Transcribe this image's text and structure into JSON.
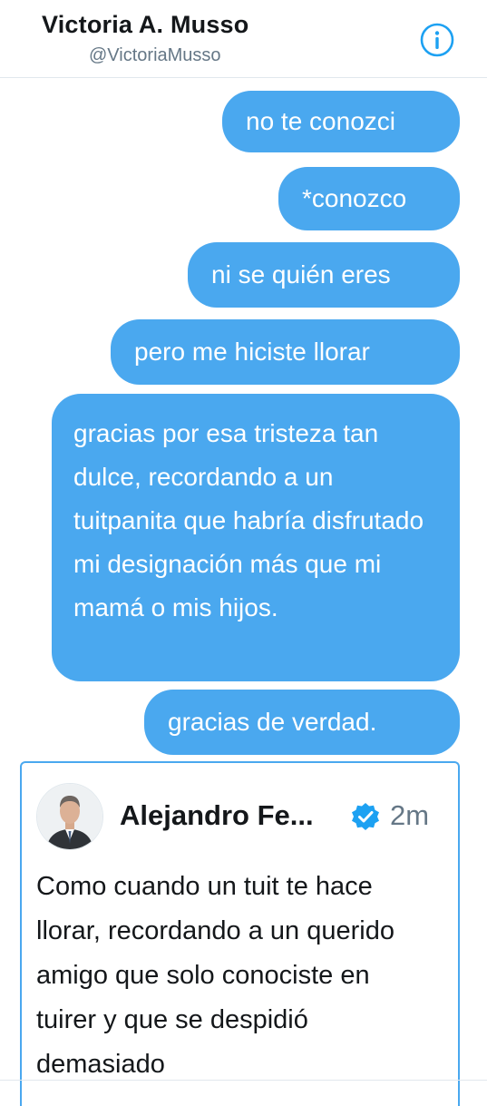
{
  "header": {
    "name": "Victoria A. Musso",
    "handle": "@VictoriaMusso",
    "info_icon": "info-circle-icon"
  },
  "messages": [
    {
      "text": "no te conozci"
    },
    {
      "text": "*conozco"
    },
    {
      "text": "ni se quién eres"
    },
    {
      "text": "pero me hiciste llorar"
    },
    {
      "text": "gracias por esa tristeza tan dulce, recordando a un tuitpanita que habría disfrutado mi designación más que mi mamá o mis hijos."
    },
    {
      "text": "gracias de verdad."
    }
  ],
  "shared_tweet": {
    "author": "Alejandro Fe...",
    "verified_icon": "verified-badge-icon",
    "time": "2m",
    "text": "Como cuando un tuit te hace llorar, recordando a un querido amigo que solo conociste en tuirer y que se despidió demasiado"
  },
  "colors": {
    "bubble": "#4aa8ef",
    "accent": "#1da1f2",
    "text": "#14171a",
    "muted": "#657786"
  }
}
